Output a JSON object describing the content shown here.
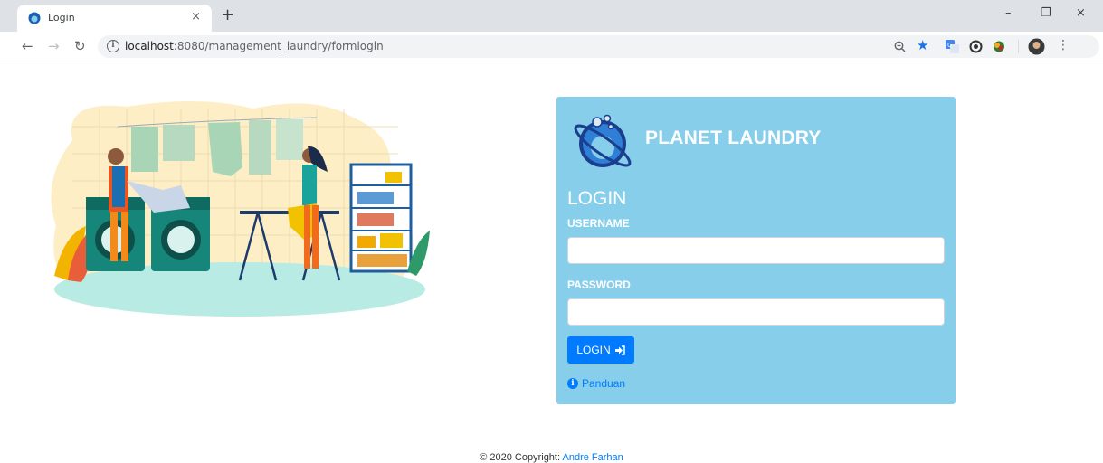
{
  "browser": {
    "tab_title": "Login",
    "tab_close": "×",
    "new_tab": "+",
    "url_host": "localhost",
    "url_path": ":8080/management_laundry/formlogin",
    "minimize": "–",
    "restore": "❐",
    "close": "×",
    "menu": "⋮"
  },
  "login": {
    "brand": "PLANET LAUNDRY",
    "heading": "LOGIN",
    "username_label": "USERNAME",
    "username_value": "",
    "password_label": "PASSWORD",
    "password_value": "",
    "button_label": "LOGIN",
    "guide_label": "Panduan",
    "colors": {
      "card": "#87ceeb",
      "button": "#007bff"
    }
  },
  "footer": {
    "prefix": "© 2020 Copyright:",
    "author": "Andre Farhan"
  }
}
